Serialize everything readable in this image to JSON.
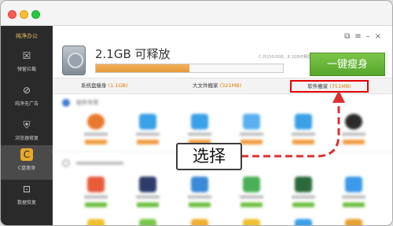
{
  "sidebar": {
    "brand": "纯净办公",
    "items": [
      {
        "label": "弹窗拦截",
        "icon": "popup-block-icon",
        "glyph": "☒"
      },
      {
        "label": "纯净无广告",
        "icon": "no-ads-icon",
        "glyph": "⊘"
      },
      {
        "label": "浏览器修复",
        "icon": "shield-icon",
        "glyph": "⛨"
      },
      {
        "label": "C盘瘦身",
        "icon": "c-disk-slim-icon",
        "glyph": "C"
      },
      {
        "label": "数据恢复",
        "icon": "data-recovery-icon",
        "glyph": "⊡"
      }
    ]
  },
  "header": {
    "free_space": "2.1GB 可释放",
    "usage_text": "C:共150.0GB，8.1GB可释放",
    "progress_fraction": 0.5,
    "primary_button": "一键瘦身",
    "window_icons": "⧉≡–×"
  },
  "tabs": [
    {
      "label": "系统盘瘦身 ",
      "count": "(1.1GB)"
    },
    {
      "label": "大文件搬家 ",
      "count": "(321MB)"
    },
    {
      "label": "软件搬家 ",
      "count": "(751MB)"
    }
  ],
  "section": {
    "title": "软件专项"
  },
  "annotation": {
    "text": "选择"
  },
  "colors": {
    "accent_green": "#5fb134",
    "highlight_red": "#e30000",
    "arrow_red": "#dc3030",
    "sidebar_bg": "#2a2a2a"
  }
}
